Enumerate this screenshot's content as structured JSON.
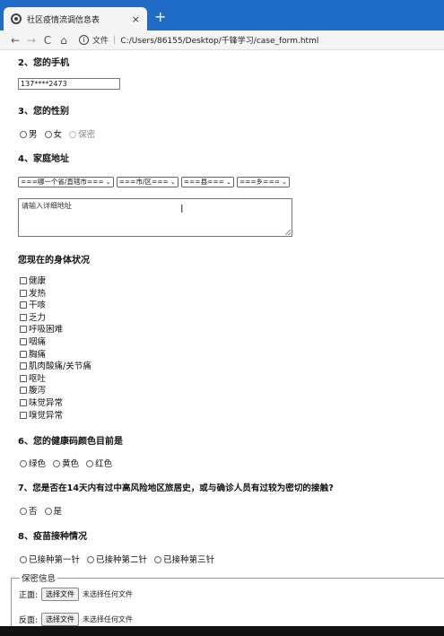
{
  "browser": {
    "tab_title": "社区疫情流调信息表",
    "tab_close": "×",
    "new_tab": "+",
    "nav": {
      "back": "←",
      "forward": "→",
      "reload": "C",
      "home": "⌂"
    },
    "url_label": "文件",
    "url": "C:/Users/86155/Desktop/千锋学习/case_form.html"
  },
  "form": {
    "phone": {
      "label": "2、您的手机",
      "value": "137****2473"
    },
    "gender": {
      "label": "3、您的性别",
      "options": [
        "男",
        "女",
        "保密"
      ]
    },
    "address": {
      "label": "4、家庭地址",
      "selects": [
        "===哪一个省/直辖市===",
        "===市/区===",
        "===县===",
        "===乡==="
      ],
      "detail_placeholder": "请输入详细地址"
    },
    "health": {
      "label": "您现在的身体状况",
      "options": [
        "健康",
        "发热",
        "干咳",
        "乏力",
        "呼吸困难",
        "咽痛",
        "胸痛",
        "肌肉酸痛/关节痛",
        "呕吐",
        "腹泻",
        "味觉异常",
        "嗅觉异常"
      ]
    },
    "code_color": {
      "label": "6、您的健康码颜色目前是",
      "options": [
        "绿色",
        "黄色",
        "红色"
      ]
    },
    "travel": {
      "label": "7、您是否在14天内有过中高风险地区旅居史，或与确诊人员有过较为密切的接触?",
      "options": [
        "否",
        "是"
      ]
    },
    "vaccine": {
      "label": "8、疫苗接种情况",
      "options": [
        "已接种第一针",
        "已接种第二针",
        "已接种第三针"
      ]
    },
    "secret": {
      "legend": "保密信息",
      "front_label": "正面:",
      "back_label": "反面:",
      "file_button": "选择文件",
      "no_file": "未选择任何文件"
    }
  }
}
